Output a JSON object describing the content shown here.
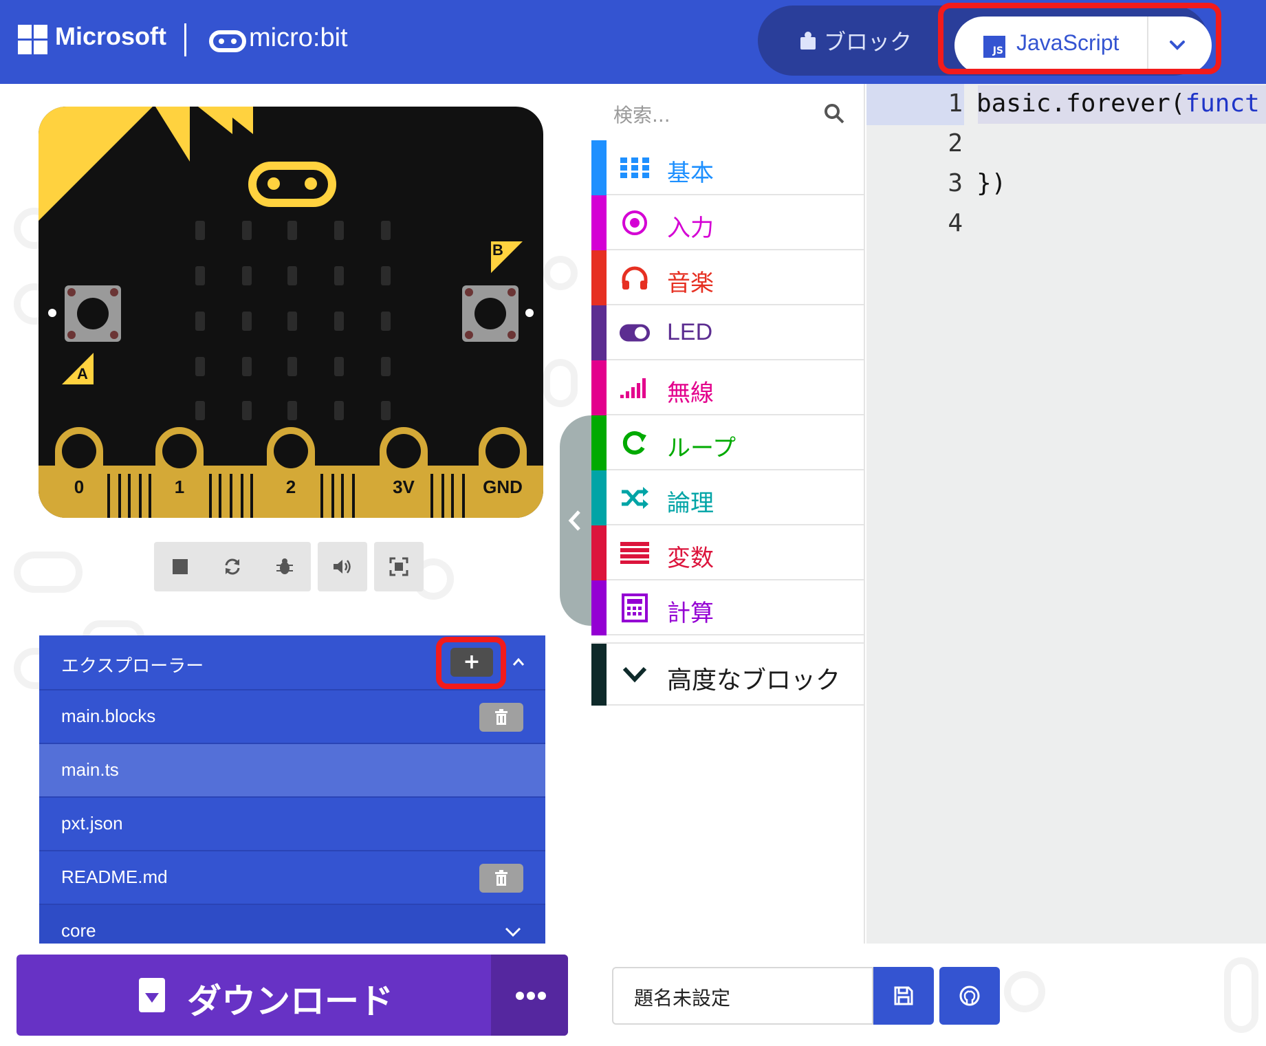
{
  "header": {
    "brand": "Microsoft",
    "product": "micro:bit",
    "blocks_label": "ブロック",
    "javascript_label": "JavaScript",
    "js_badge": "JS"
  },
  "simulator": {
    "button_a_label": "A",
    "button_b_label": "B",
    "pins": [
      "0",
      "1",
      "2",
      "3V",
      "GND"
    ],
    "controls": [
      "stop-icon",
      "restart-icon",
      "debug-icon",
      "sound-icon",
      "fullscreen-icon"
    ]
  },
  "explorer": {
    "title": "エクスプローラー",
    "add_label": "+",
    "files": [
      {
        "name": "main.blocks",
        "deletable": true,
        "selected": false
      },
      {
        "name": "main.ts",
        "deletable": false,
        "selected": true
      },
      {
        "name": "pxt.json",
        "deletable": false,
        "selected": false
      },
      {
        "name": "README.md",
        "deletable": true,
        "selected": false
      },
      {
        "name": "core",
        "deletable": false,
        "selected": false
      }
    ]
  },
  "download": {
    "label": "ダウンロード"
  },
  "toolbox": {
    "search_placeholder": "検索...",
    "categories": [
      {
        "label": "基本",
        "color": "#1E90FF",
        "icon": "grid-icon"
      },
      {
        "label": "入力",
        "color": "#D400D4",
        "icon": "target-icon"
      },
      {
        "label": "音楽",
        "color": "#E63022",
        "icon": "headphones-icon"
      },
      {
        "label": "LED",
        "color": "#5C2D91",
        "icon": "toggle-icon"
      },
      {
        "label": "無線",
        "color": "#E3008C",
        "icon": "signal-icon"
      },
      {
        "label": "ループ",
        "color": "#00AA00",
        "icon": "loop-icon"
      },
      {
        "label": "論理",
        "color": "#00A4A6",
        "icon": "shuffle-icon"
      },
      {
        "label": "変数",
        "color": "#DC143C",
        "icon": "lines-icon"
      },
      {
        "label": "計算",
        "color": "#9400D3",
        "icon": "calculator-icon"
      }
    ],
    "advanced_label": "高度なブロック"
  },
  "editor": {
    "line_numbers": [
      "1",
      "2",
      "3",
      "4"
    ],
    "line1_prefix": "basic.forever(",
    "line1_keyword": "funct",
    "line3": "})"
  },
  "project": {
    "name": "題名未設定"
  },
  "colors": {
    "header": "#3454D1",
    "download": "#6732C5",
    "highlight": "#F21B1B"
  }
}
